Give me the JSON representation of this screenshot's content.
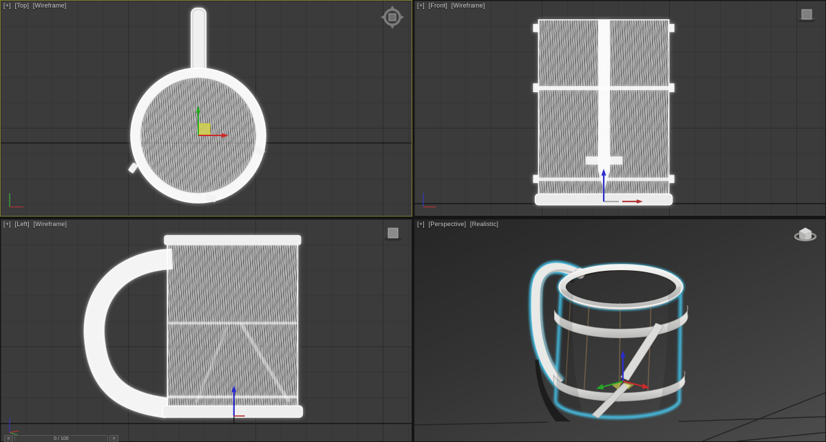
{
  "viewports": [
    {
      "id": "top",
      "general_menu": "[+]",
      "pov_menu": "[Top]",
      "shading_menu": "[Wireframe]",
      "active": true
    },
    {
      "id": "front",
      "general_menu": "[+]",
      "pov_menu": "[Front]",
      "shading_menu": "[Wireframe]",
      "active": false
    },
    {
      "id": "left",
      "general_menu": "[+]",
      "pov_menu": "[Left]",
      "shading_menu": "[Wireframe]",
      "active": false
    },
    {
      "id": "perspective",
      "general_menu": "[+]",
      "pov_menu": "[Perspective]",
      "shading_menu": "[Realistic]",
      "active": false
    }
  ],
  "scene": {
    "object_name": "wooden tankard mug",
    "wireframe_color": "#ffffff",
    "selection_outline_color": "#4ac4ec",
    "wood_color": "#c9a176",
    "metal_band_color": "#e8e8e6"
  },
  "gizmo": {
    "axis_x_color": "#cc2a2a",
    "axis_y_color": "#27a827",
    "axis_z_color": "#2b2bd0",
    "plane_handle_color": "#d8d84e"
  },
  "grid": {
    "viewport_bg": "#3b3b3b",
    "origin_line_color": "#191919",
    "active_border_color": "#7f7f35"
  },
  "icons": {
    "viewcube_top": "viewcube-orthographic-top",
    "viewcube_front": "viewcube-orthographic-face",
    "viewcube_left": "viewcube-orthographic-face",
    "viewcube_perspective": "viewcube-3d-home"
  },
  "timeline": {
    "prev_label": "<",
    "next_label": ">",
    "frame_display": "0 / 100"
  }
}
